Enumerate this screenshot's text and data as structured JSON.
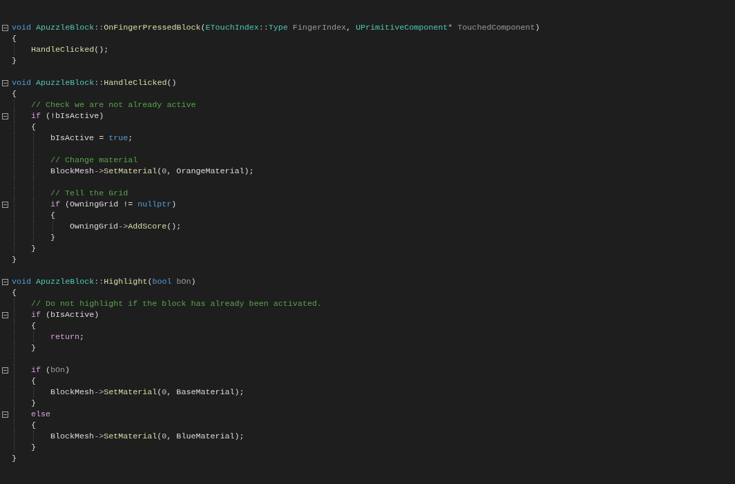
{
  "code": [
    {
      "kind": "foldable",
      "expanded": true,
      "tokens": [
        {
          "kind": "keyword",
          "text": "void"
        },
        {
          "kind": "type",
          "text": " ApuzzleBlock"
        },
        {
          "kind": "operator",
          "text": "::"
        },
        {
          "kind": "function",
          "text": "OnFingerPressedBlock"
        },
        {
          "kind": "plain",
          "text": "("
        },
        {
          "kind": "type",
          "text": "ETouchIndex"
        },
        {
          "kind": "operator",
          "text": "::"
        },
        {
          "kind": "type",
          "text": "Type"
        },
        {
          "kind": "parameter",
          "text": " FingerIndex"
        },
        {
          "kind": "plain",
          "text": ", "
        },
        {
          "kind": "type",
          "text": "UPrimitiveComponent"
        },
        {
          "kind": "operator",
          "text": "*"
        },
        {
          "kind": "parameter",
          "text": " TouchedComponent"
        },
        {
          "kind": "plain",
          "text": ")"
        }
      ]
    },
    {
      "kind": "code",
      "tokens": [
        {
          "kind": "plain",
          "text": "{"
        }
      ],
      "children": [
        {
          "kind": "code",
          "tokens": [
            {
              "kind": "function",
              "text": "HandleClicked"
            },
            {
              "kind": "plain",
              "text": "();"
            }
          ]
        }
      ]
    },
    {
      "kind": "code",
      "tokens": [
        {
          "kind": "plain",
          "text": "}"
        }
      ]
    },
    {
      "kind": "blank"
    },
    {
      "kind": "foldable",
      "expanded": true,
      "tokens": [
        {
          "kind": "keyword",
          "text": "void"
        },
        {
          "kind": "type",
          "text": " ApuzzleBlock"
        },
        {
          "kind": "operator",
          "text": "::"
        },
        {
          "kind": "function",
          "text": "HandleClicked"
        },
        {
          "kind": "plain",
          "text": "()"
        }
      ]
    },
    {
      "kind": "code",
      "tokens": [
        {
          "kind": "plain",
          "text": "{"
        }
      ],
      "children": [
        {
          "kind": "code",
          "tokens": [
            {
              "kind": "comment",
              "text": "// Check we are not already active"
            }
          ]
        },
        {
          "kind": "foldable",
          "expanded": true,
          "tokens": [
            {
              "kind": "control",
              "text": "if"
            },
            {
              "kind": "plain",
              "text": " (!bIsActive)"
            }
          ]
        },
        {
          "kind": "code",
          "tokens": [
            {
              "kind": "plain",
              "text": "{"
            }
          ],
          "children": [
            {
              "kind": "code",
              "tokens": [
                {
                  "kind": "plain",
                  "text": "bIsActive = "
                },
                {
                  "kind": "keyword",
                  "text": "true"
                },
                {
                  "kind": "plain",
                  "text": ";"
                }
              ]
            },
            {
              "kind": "blank"
            },
            {
              "kind": "code",
              "tokens": [
                {
                  "kind": "comment",
                  "text": "// Change material"
                }
              ]
            },
            {
              "kind": "code",
              "tokens": [
                {
                  "kind": "plain",
                  "text": "BlockMesh"
                },
                {
                  "kind": "operator",
                  "text": "->"
                },
                {
                  "kind": "function",
                  "text": "SetMaterial"
                },
                {
                  "kind": "plain",
                  "text": "("
                },
                {
                  "kind": "number",
                  "text": "0"
                },
                {
                  "kind": "plain",
                  "text": ", OrangeMaterial);"
                }
              ]
            },
            {
              "kind": "blank"
            },
            {
              "kind": "code",
              "tokens": [
                {
                  "kind": "comment",
                  "text": "// Tell the Grid"
                }
              ]
            },
            {
              "kind": "foldable",
              "expanded": true,
              "tokens": [
                {
                  "kind": "control",
                  "text": "if"
                },
                {
                  "kind": "plain",
                  "text": " (OwningGrid != "
                },
                {
                  "kind": "keyword",
                  "text": "nullptr"
                },
                {
                  "kind": "plain",
                  "text": ")"
                }
              ]
            },
            {
              "kind": "code",
              "tokens": [
                {
                  "kind": "plain",
                  "text": "{"
                }
              ],
              "children": [
                {
                  "kind": "code",
                  "tokens": [
                    {
                      "kind": "plain",
                      "text": "OwningGrid"
                    },
                    {
                      "kind": "operator",
                      "text": "->"
                    },
                    {
                      "kind": "function",
                      "text": "AddScore"
                    },
                    {
                      "kind": "plain",
                      "text": "();"
                    }
                  ]
                }
              ]
            },
            {
              "kind": "code",
              "tokens": [
                {
                  "kind": "plain",
                  "text": "}"
                }
              ]
            }
          ]
        },
        {
          "kind": "code",
          "tokens": [
            {
              "kind": "plain",
              "text": "}"
            }
          ]
        }
      ]
    },
    {
      "kind": "code",
      "tokens": [
        {
          "kind": "plain",
          "text": "}"
        }
      ]
    },
    {
      "kind": "blank"
    },
    {
      "kind": "foldable",
      "expanded": true,
      "tokens": [
        {
          "kind": "keyword",
          "text": "void"
        },
        {
          "kind": "type",
          "text": " ApuzzleBlock"
        },
        {
          "kind": "operator",
          "text": "::"
        },
        {
          "kind": "function",
          "text": "Highlight"
        },
        {
          "kind": "plain",
          "text": "("
        },
        {
          "kind": "keyword",
          "text": "bool"
        },
        {
          "kind": "parameter",
          "text": " bOn"
        },
        {
          "kind": "plain",
          "text": ")"
        }
      ]
    },
    {
      "kind": "code",
      "tokens": [
        {
          "kind": "plain",
          "text": "{"
        }
      ],
      "children": [
        {
          "kind": "code",
          "tokens": [
            {
              "kind": "comment",
              "text": "// Do not highlight if the block has already been activated."
            }
          ]
        },
        {
          "kind": "foldable",
          "expanded": true,
          "tokens": [
            {
              "kind": "control",
              "text": "if"
            },
            {
              "kind": "plain",
              "text": " (bIsActive)"
            }
          ]
        },
        {
          "kind": "code",
          "tokens": [
            {
              "kind": "plain",
              "text": "{"
            }
          ],
          "children": [
            {
              "kind": "code",
              "tokens": [
                {
                  "kind": "control",
                  "text": "return"
                },
                {
                  "kind": "plain",
                  "text": ";"
                }
              ]
            }
          ]
        },
        {
          "kind": "code",
          "tokens": [
            {
              "kind": "plain",
              "text": "}"
            }
          ]
        },
        {
          "kind": "blank"
        },
        {
          "kind": "foldable",
          "expanded": true,
          "tokens": [
            {
              "kind": "control",
              "text": "if"
            },
            {
              "kind": "plain",
              "text": " ("
            },
            {
              "kind": "parameter",
              "text": "bOn"
            },
            {
              "kind": "plain",
              "text": ")"
            }
          ]
        },
        {
          "kind": "code",
          "tokens": [
            {
              "kind": "plain",
              "text": "{"
            }
          ],
          "children": [
            {
              "kind": "code",
              "tokens": [
                {
                  "kind": "plain",
                  "text": "BlockMesh"
                },
                {
                  "kind": "operator",
                  "text": "->"
                },
                {
                  "kind": "function",
                  "text": "SetMaterial"
                },
                {
                  "kind": "plain",
                  "text": "("
                },
                {
                  "kind": "number",
                  "text": "0"
                },
                {
                  "kind": "plain",
                  "text": ", BaseMaterial);"
                }
              ]
            }
          ]
        },
        {
          "kind": "code",
          "tokens": [
            {
              "kind": "plain",
              "text": "}"
            }
          ]
        },
        {
          "kind": "foldable",
          "expanded": true,
          "tokens": [
            {
              "kind": "control",
              "text": "else"
            }
          ]
        },
        {
          "kind": "code",
          "tokens": [
            {
              "kind": "plain",
              "text": "{"
            }
          ],
          "children": [
            {
              "kind": "code",
              "tokens": [
                {
                  "kind": "plain",
                  "text": "BlockMesh"
                },
                {
                  "kind": "operator",
                  "text": "->"
                },
                {
                  "kind": "function",
                  "text": "SetMaterial"
                },
                {
                  "kind": "plain",
                  "text": "("
                },
                {
                  "kind": "number",
                  "text": "0"
                },
                {
                  "kind": "plain",
                  "text": ", BlueMaterial);"
                }
              ]
            }
          ]
        },
        {
          "kind": "code",
          "tokens": [
            {
              "kind": "plain",
              "text": "}"
            }
          ]
        }
      ]
    },
    {
      "kind": "code",
      "tokens": [
        {
          "kind": "plain",
          "text": "}"
        }
      ]
    }
  ]
}
